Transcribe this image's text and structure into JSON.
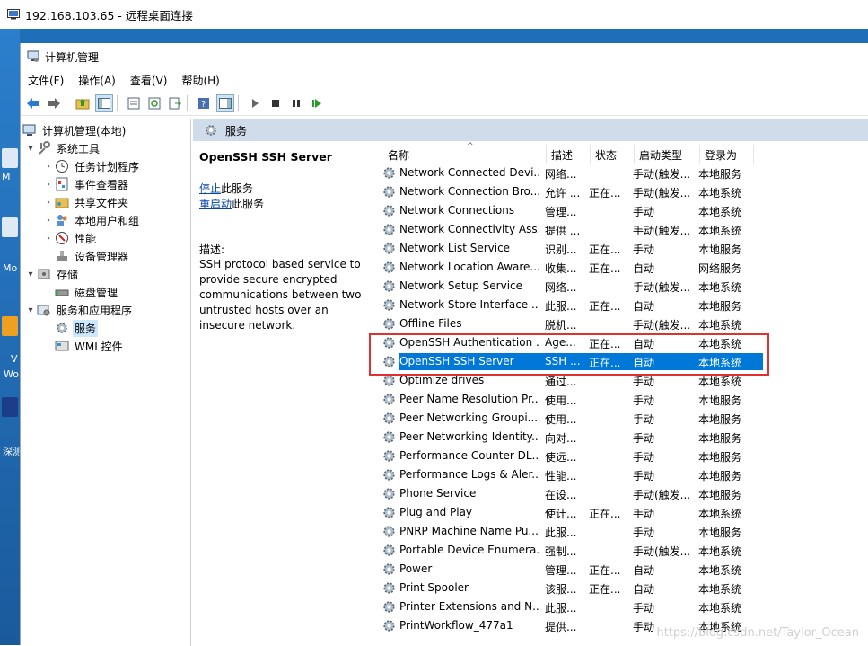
{
  "rdp": {
    "title": "192.168.103.65 - 远程桌面连接"
  },
  "desktop": {
    "labels": [
      "M",
      "Mo",
      "V",
      "Wo",
      "深测"
    ]
  },
  "window": {
    "title": "计算机管理",
    "menu": [
      "文件(F)",
      "操作(A)",
      "查看(V)",
      "帮助(H)"
    ]
  },
  "toolbar": {
    "icons": [
      "back-icon",
      "forward-icon",
      "up-folder-icon",
      "show-hide-tree-icon",
      "properties-icon",
      "refresh-icon",
      "export-list-icon",
      "help-icon",
      "show-hide-action-pane-icon",
      "play-icon",
      "stop-icon",
      "pause-icon",
      "restart-icon"
    ]
  },
  "tree": [
    {
      "label": "计算机管理(本地)",
      "level": 0,
      "arrow": "",
      "icon": "computer-management-icon"
    },
    {
      "label": "系统工具",
      "level": 1,
      "arrow": "▾",
      "icon": "tools-icon"
    },
    {
      "label": "任务计划程序",
      "level": 2,
      "arrow": "›",
      "icon": "task-scheduler-icon"
    },
    {
      "label": "事件查看器",
      "level": 2,
      "arrow": "›",
      "icon": "event-viewer-icon"
    },
    {
      "label": "共享文件夹",
      "level": 2,
      "arrow": "›",
      "icon": "shared-folders-icon"
    },
    {
      "label": "本地用户和组",
      "level": 2,
      "arrow": "›",
      "icon": "users-groups-icon"
    },
    {
      "label": "性能",
      "level": 2,
      "arrow": "›",
      "icon": "performance-icon"
    },
    {
      "label": "设备管理器",
      "level": 2,
      "arrow": "",
      "icon": "device-manager-icon"
    },
    {
      "label": "存储",
      "level": 1,
      "arrow": "▾",
      "icon": "storage-icon"
    },
    {
      "label": "磁盘管理",
      "level": 2,
      "arrow": "",
      "icon": "disk-management-icon"
    },
    {
      "label": "服务和应用程序",
      "level": 1,
      "arrow": "▾",
      "icon": "services-apps-icon"
    },
    {
      "label": "服务",
      "level": 2,
      "arrow": "",
      "icon": "services-icon",
      "selected": true
    },
    {
      "label": "WMI 控件",
      "level": 2,
      "arrow": "",
      "icon": "wmi-icon"
    }
  ],
  "services_header": {
    "title": "服务"
  },
  "detail": {
    "title": "OpenSSH SSH Server",
    "stop_link": "停止",
    "stop_suffix": "此服务",
    "restart_link": "重启动",
    "restart_suffix": "此服务",
    "desc_label": "描述:",
    "desc_text": "SSH protocol based service to provide secure encrypted communications between two untrusted hosts over an insecure network."
  },
  "columns": {
    "name": "名称",
    "desc": "描述",
    "status": "状态",
    "startup": "启动类型",
    "logon": "登录为"
  },
  "services": [
    {
      "name": "Network Connected Devi...",
      "desc": "网络...",
      "status": "",
      "startup": "手动(触发...",
      "logon": "本地服务"
    },
    {
      "name": "Network Connection Bro...",
      "desc": "允许 ...",
      "status": "正在...",
      "startup": "手动(触发...",
      "logon": "本地系统"
    },
    {
      "name": "Network Connections",
      "desc": "管理...",
      "status": "",
      "startup": "手动",
      "logon": "本地系统"
    },
    {
      "name": "Network Connectivity Ass...",
      "desc": "提供 ...",
      "status": "",
      "startup": "手动(触发...",
      "logon": "本地系统"
    },
    {
      "name": "Network List Service",
      "desc": "识别...",
      "status": "正在...",
      "startup": "手动",
      "logon": "本地服务"
    },
    {
      "name": "Network Location Aware...",
      "desc": "收集...",
      "status": "正在...",
      "startup": "自动",
      "logon": "网络服务"
    },
    {
      "name": "Network Setup Service",
      "desc": "网络...",
      "status": "",
      "startup": "手动(触发...",
      "logon": "本地系统"
    },
    {
      "name": "Network Store Interface ...",
      "desc": "此服...",
      "status": "正在...",
      "startup": "自动",
      "logon": "本地服务"
    },
    {
      "name": "Offline Files",
      "desc": "脱机...",
      "status": "",
      "startup": "手动(触发...",
      "logon": "本地系统"
    },
    {
      "name": "OpenSSH Authentication ...",
      "desc": "Age...",
      "status": "正在...",
      "startup": "自动",
      "logon": "本地系统"
    },
    {
      "name": "OpenSSH SSH Server",
      "desc": "SSH ...",
      "status": "正在...",
      "startup": "自动",
      "logon": "本地系统",
      "selected": true
    },
    {
      "name": "Optimize drives",
      "desc": "通过...",
      "status": "",
      "startup": "手动",
      "logon": "本地系统"
    },
    {
      "name": "Peer Name Resolution Pr...",
      "desc": "使用...",
      "status": "",
      "startup": "手动",
      "logon": "本地服务"
    },
    {
      "name": "Peer Networking Groupi...",
      "desc": "使用...",
      "status": "",
      "startup": "手动",
      "logon": "本地服务"
    },
    {
      "name": "Peer Networking Identity...",
      "desc": "向对...",
      "status": "",
      "startup": "手动",
      "logon": "本地服务"
    },
    {
      "name": "Performance Counter DL...",
      "desc": "使远...",
      "status": "",
      "startup": "手动",
      "logon": "本地服务"
    },
    {
      "name": "Performance Logs & Aler...",
      "desc": "性能...",
      "status": "",
      "startup": "手动",
      "logon": "本地服务"
    },
    {
      "name": "Phone Service",
      "desc": "在设...",
      "status": "",
      "startup": "手动(触发...",
      "logon": "本地服务"
    },
    {
      "name": "Plug and Play",
      "desc": "使计...",
      "status": "正在...",
      "startup": "手动",
      "logon": "本地系统"
    },
    {
      "name": "PNRP Machine Name Pu...",
      "desc": "此服...",
      "status": "",
      "startup": "手动",
      "logon": "本地服务"
    },
    {
      "name": "Portable Device Enumera...",
      "desc": "强制...",
      "status": "",
      "startup": "手动(触发...",
      "logon": "本地系统"
    },
    {
      "name": "Power",
      "desc": "管理...",
      "status": "正在...",
      "startup": "自动",
      "logon": "本地系统"
    },
    {
      "name": "Print Spooler",
      "desc": "该服...",
      "status": "正在...",
      "startup": "自动",
      "logon": "本地系统"
    },
    {
      "name": "Printer Extensions and N...",
      "desc": "此服...",
      "status": "",
      "startup": "手动",
      "logon": "本地系统"
    },
    {
      "name": "PrintWorkflow_477a1",
      "desc": "提供...",
      "status": "",
      "startup": "手动",
      "logon": "本地系统"
    }
  ],
  "watermark": "https://blog.csdn.net/Taylor_Ocean",
  "colors": {
    "selection": "#0078d7",
    "header": "#d0dcea",
    "highlight_box": "#e03030",
    "tree_selection": "#cce8ff"
  }
}
